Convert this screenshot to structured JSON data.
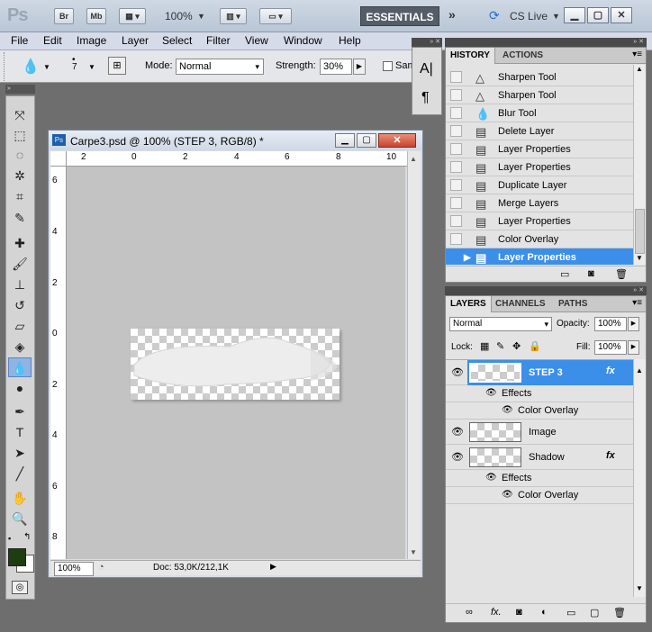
{
  "app": {
    "logo": "Ps",
    "bridge": "Br",
    "minibridge": "Mb",
    "zoom": "100%",
    "workspace": "ESSENTIALS",
    "cslive": "CS Live"
  },
  "menu": [
    "File",
    "Edit",
    "Image",
    "Layer",
    "Select",
    "Filter",
    "View",
    "Window",
    "Help"
  ],
  "options": {
    "brush_size": "7",
    "mode_label": "Mode:",
    "mode_value": "Normal",
    "strength_label": "Strength:",
    "strength_value": "30%",
    "sample_label": "Sam"
  },
  "document": {
    "title": "Carpe3.psd @ 100% (STEP 3, RGB/8) *",
    "ruler_top": [
      "2",
      "0",
      "2",
      "4",
      "6",
      "8",
      "10"
    ],
    "ruler_left": [
      "6",
      "4",
      "2",
      "0",
      "2",
      "4",
      "6",
      "8"
    ],
    "zoom": "100%",
    "doc_info": "Doc: 53,0K/212,1K"
  },
  "history": {
    "tabs": [
      "HISTORY",
      "ACTIONS"
    ],
    "items": [
      {
        "label": "Sharpen Tool",
        "icon": "sharpen-icon"
      },
      {
        "label": "Sharpen Tool",
        "icon": "sharpen-icon"
      },
      {
        "label": "Blur Tool",
        "icon": "blur-icon"
      },
      {
        "label": "Delete Layer",
        "icon": "history-state-icon"
      },
      {
        "label": "Layer Properties",
        "icon": "history-state-icon"
      },
      {
        "label": "Layer Properties",
        "icon": "history-state-icon"
      },
      {
        "label": "Duplicate Layer",
        "icon": "history-state-icon"
      },
      {
        "label": "Merge Layers",
        "icon": "history-state-icon"
      },
      {
        "label": "Layer Properties",
        "icon": "history-state-icon"
      },
      {
        "label": "Color Overlay",
        "icon": "history-state-icon"
      },
      {
        "label": "Layer Properties",
        "icon": "history-state-icon"
      }
    ]
  },
  "layers": {
    "tabs": [
      "LAYERS",
      "CHANNELS",
      "PATHS"
    ],
    "blend_mode": "Normal",
    "opacity_label": "Opacity:",
    "opacity_value": "100%",
    "lock_label": "Lock:",
    "fill_label": "Fill:",
    "fill_value": "100%",
    "items": [
      {
        "name": "STEP 3",
        "fx": "fx",
        "effects": "Effects",
        "effect": "Color Overlay"
      },
      {
        "name": "Image"
      },
      {
        "name": "Shadow",
        "fx": "fx",
        "effects": "Effects",
        "effect": "Color Overlay"
      }
    ]
  },
  "colors": {
    "foreground": "#1e3d10",
    "background": "#ffffff",
    "selection": "#3b8fe8"
  }
}
